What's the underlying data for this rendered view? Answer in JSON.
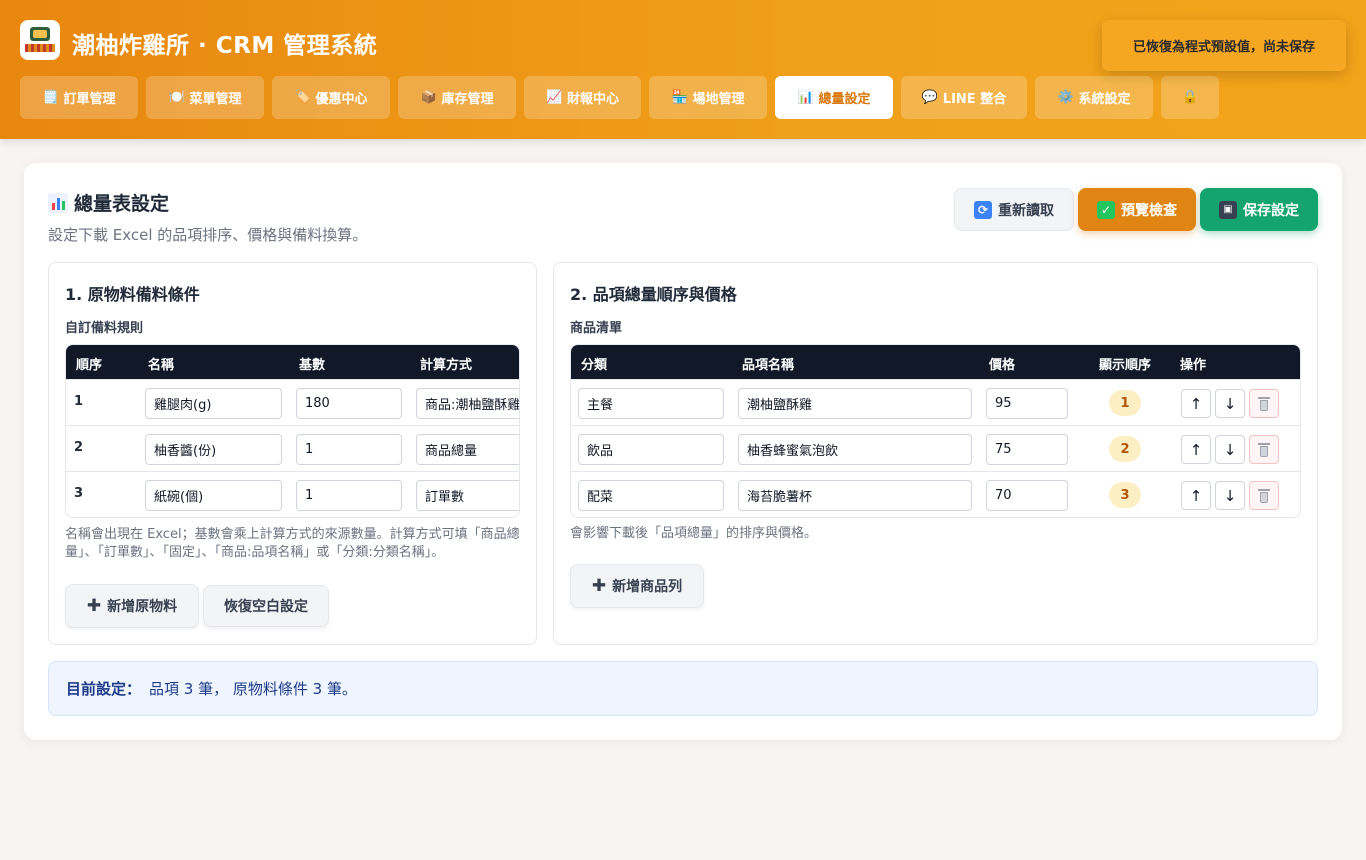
{
  "header": {
    "app_title": "潮柚炸雞所 · CRM 管理系統",
    "toast": "已恢復為程式預設值，尚未保存"
  },
  "nav": [
    {
      "icon": "🗒️",
      "label": "訂單管理"
    },
    {
      "icon": "🍽️",
      "label": "菜單管理"
    },
    {
      "icon": "🏷️",
      "label": "優惠中心"
    },
    {
      "icon": "📦",
      "label": "庫存管理"
    },
    {
      "icon": "📈",
      "label": "財報中心"
    },
    {
      "icon": "🏪",
      "label": "場地管理"
    },
    {
      "icon": "📊",
      "label": "總量設定"
    },
    {
      "icon": "💬",
      "label": "LINE 整合"
    },
    {
      "icon": "⚙️",
      "label": "系統設定"
    },
    {
      "icon": "🔒",
      "label": ""
    }
  ],
  "page": {
    "title": "總量表設定",
    "subtitle": "設定下載 Excel 的品項排序、價格與備料換算。",
    "reload_label": "重新讀取",
    "preview_label": "預覽檢查",
    "save_label": "保存設定"
  },
  "materials": {
    "title": "1. 原物料備料條件",
    "subtitle": "自訂備料規則",
    "columns": [
      "順序",
      "名稱",
      "基數",
      "計算方式"
    ],
    "rows": [
      {
        "order": "1",
        "name": "雞腿肉(g)",
        "base": "180",
        "method": "商品:潮柚鹽酥雞"
      },
      {
        "order": "2",
        "name": "柚香醬(份)",
        "base": "1",
        "method": "商品總量"
      },
      {
        "order": "3",
        "name": "紙碗(個)",
        "base": "1",
        "method": "訂單數"
      }
    ],
    "note": "名稱會出現在 Excel；基數會乘上計算方式的來源數量。計算方式可填「商品總量」、「訂單數」、「固定」、「商品:品項名稱」或「分類:分類名稱」。",
    "add_label": "新增原物料",
    "reset_label": "恢復空白設定"
  },
  "products": {
    "title": "2. 品項總量順序與價格",
    "subtitle": "商品清單",
    "columns": [
      "分類",
      "品項名稱",
      "價格",
      "顯示順序",
      "操作"
    ],
    "rows": [
      {
        "category": "主餐",
        "name": "潮柚鹽酥雞",
        "price": "95",
        "order": "1"
      },
      {
        "category": "飲品",
        "name": "柚香蜂蜜氣泡飲",
        "price": "75",
        "order": "2"
      },
      {
        "category": "配菜",
        "name": "海苔脆薯杯",
        "price": "70",
        "order": "3"
      }
    ],
    "up_label": "↑",
    "down_label": "↓",
    "note": "會影響下載後「品項總量」的排序與價格。",
    "add_label": "新增商品列"
  },
  "summary": {
    "label": "目前設定：",
    "text": "品項 3 筆， 原物料條件 3 筆。"
  }
}
